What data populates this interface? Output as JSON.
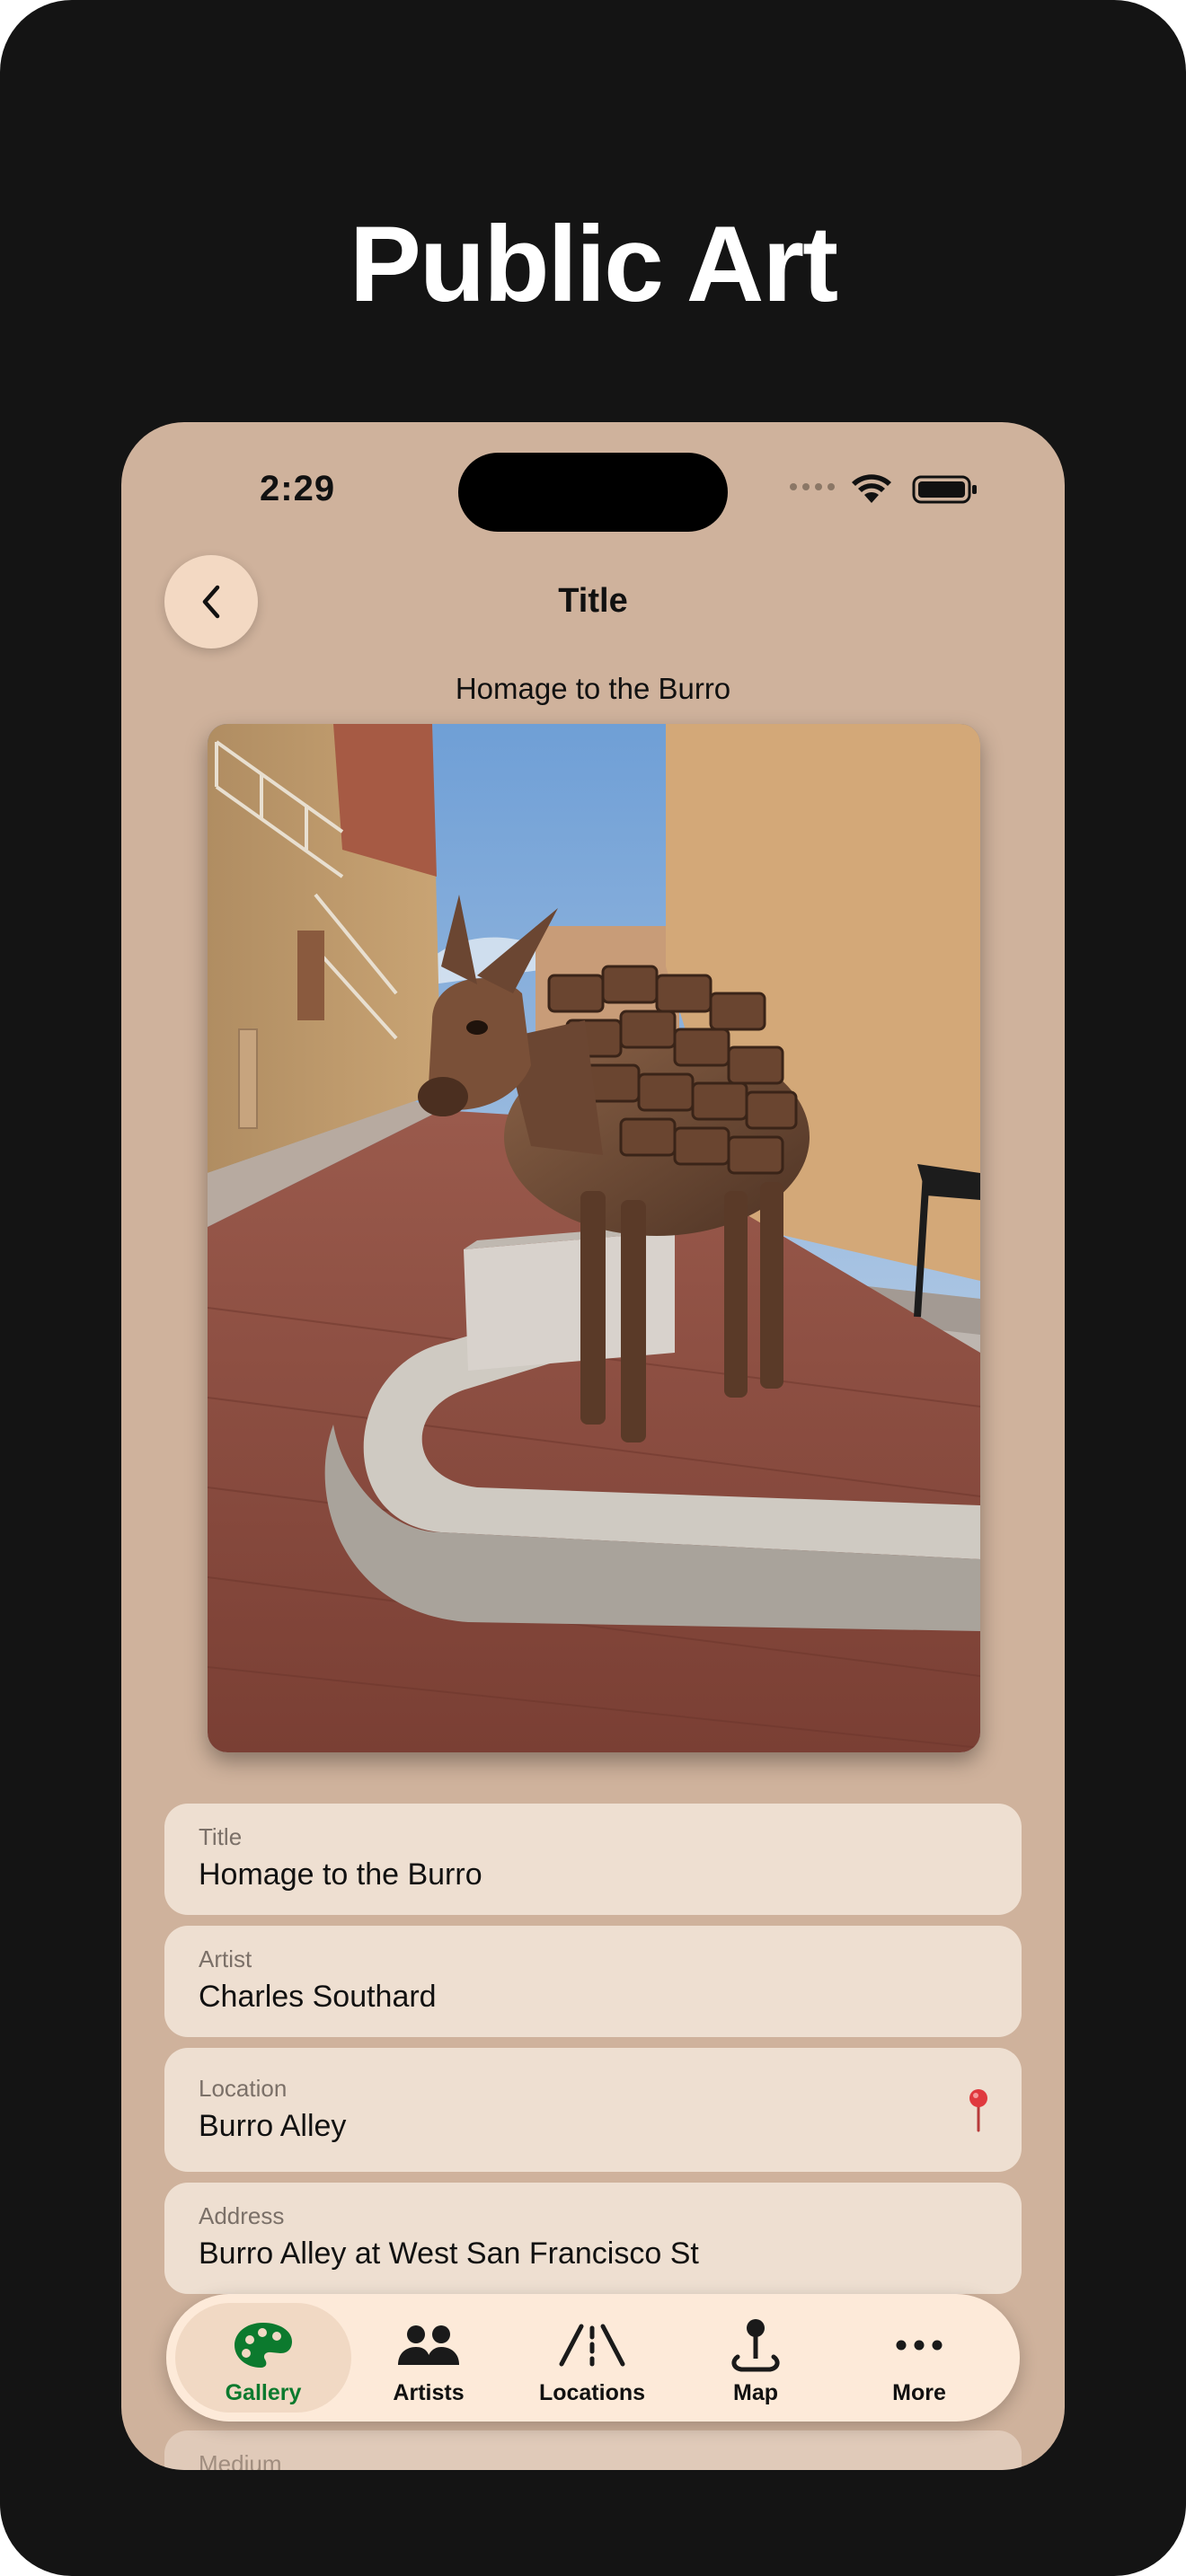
{
  "promo": {
    "headline": "Public Art"
  },
  "status_bar": {
    "time": "2:29"
  },
  "nav": {
    "title": "Title"
  },
  "artwork": {
    "caption": "Homage to the Burro"
  },
  "fields": [
    {
      "label": "Title",
      "value": "Homage to the Burro"
    },
    {
      "label": "Artist",
      "value": "Charles Southard"
    },
    {
      "label": "Location",
      "value": "Burro Alley"
    },
    {
      "label": "Address",
      "value": "Burro Alley at West San Francisco St"
    },
    {
      "label": "Medium",
      "value": ""
    }
  ],
  "tabbar": {
    "items": [
      {
        "label": "Gallery",
        "icon": "palette-icon",
        "active": true
      },
      {
        "label": "Artists",
        "icon": "people-icon",
        "active": false
      },
      {
        "label": "Locations",
        "icon": "road-icon",
        "active": false
      },
      {
        "label": "Map",
        "icon": "map-pin-joystick-icon",
        "active": false
      },
      {
        "label": "More",
        "icon": "ellipsis-icon",
        "active": false
      }
    ]
  },
  "colors": {
    "page_bg": "#141414",
    "phone_bg": "#cfb29c",
    "field_bg": "#eedfd1",
    "active_tab": "#0c7a2e",
    "pin": "#e0393e"
  }
}
